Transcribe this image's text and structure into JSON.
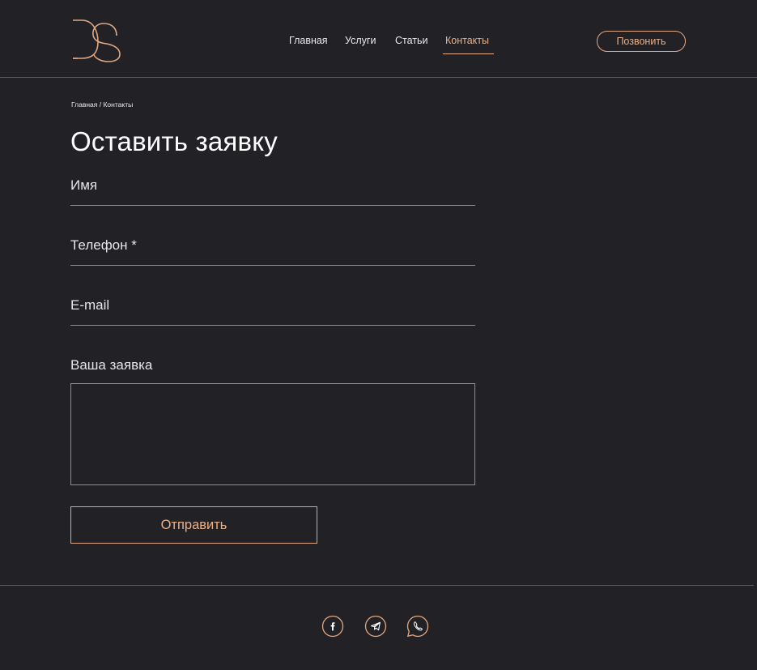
{
  "brand": {
    "logo_text": "DS",
    "accent_color": "#e8b08a",
    "background_color": "#222226"
  },
  "nav": {
    "items": [
      {
        "label": "Главная",
        "active": false
      },
      {
        "label": "Услуги",
        "active": false
      },
      {
        "label": "Статьи",
        "active": false
      },
      {
        "label": "Контакты",
        "active": true
      }
    ],
    "call_button": "Позвонить"
  },
  "breadcrumb": {
    "home": "Главная",
    "separator": "/",
    "current": "Контакты"
  },
  "form": {
    "title": "Оставить заявку",
    "name_placeholder": "Имя",
    "phone_placeholder": "Телефон *",
    "email_placeholder": "E-mail",
    "request_label": "Ваша заявка",
    "submit_label": "Отправить"
  },
  "footer": {
    "social_icons": [
      "facebook-icon",
      "telegram-icon",
      "whatsapp-icon"
    ]
  }
}
